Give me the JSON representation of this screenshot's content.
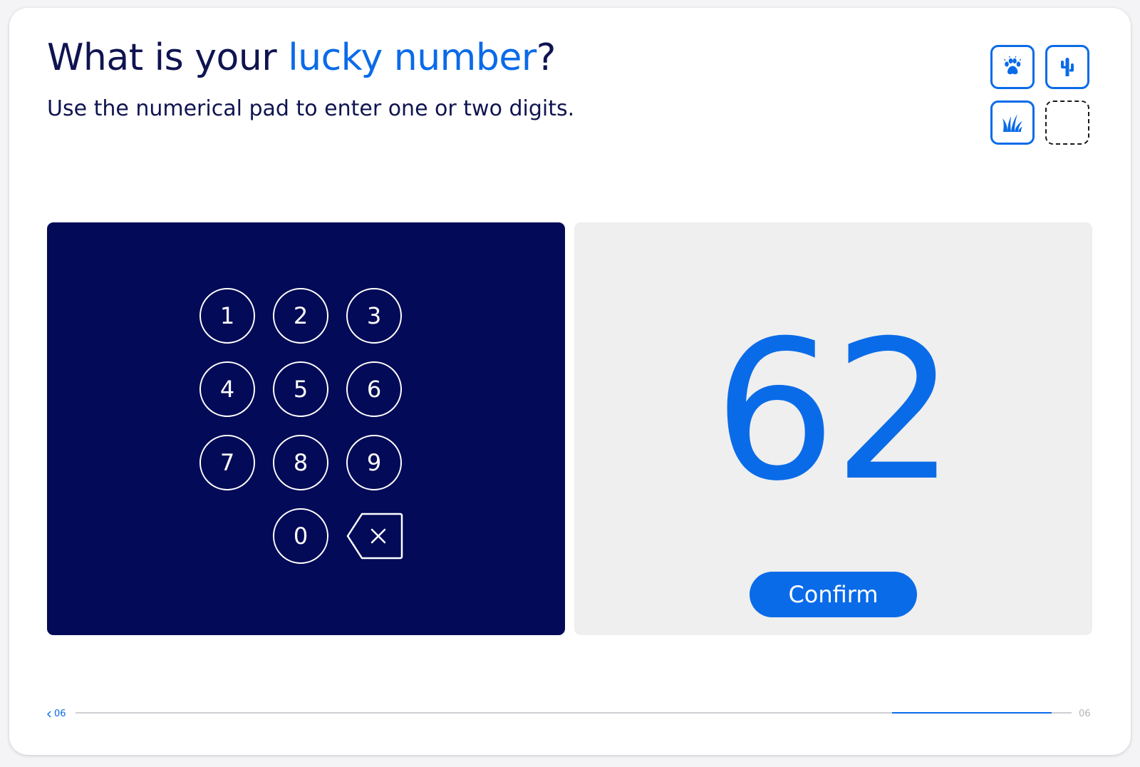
{
  "question": {
    "title_prefix": "What is your ",
    "title_highlight": "lucky number",
    "title_suffix": "?",
    "subtitle": "Use the numerical pad to enter one or two digits."
  },
  "badges": [
    {
      "icon": "paw-icon",
      "state": "filled"
    },
    {
      "icon": "cactus-icon",
      "state": "filled"
    },
    {
      "icon": "grass-icon",
      "state": "filled"
    },
    {
      "icon": "empty-slot",
      "state": "empty"
    }
  ],
  "keypad": {
    "keys": [
      "1",
      "2",
      "3",
      "4",
      "5",
      "6",
      "7",
      "8",
      "9",
      "0"
    ],
    "backspace_icon": "backspace-icon"
  },
  "display": {
    "value": "62",
    "confirm_label": "Confirm"
  },
  "footer": {
    "prev_label": "06",
    "next_label": "06",
    "progress_start": 0.82,
    "progress_end": 0.98
  },
  "colors": {
    "accent": "#0a6be8",
    "keypad_bg": "#030a57",
    "display_bg": "#efefef",
    "title": "#0f1450"
  }
}
